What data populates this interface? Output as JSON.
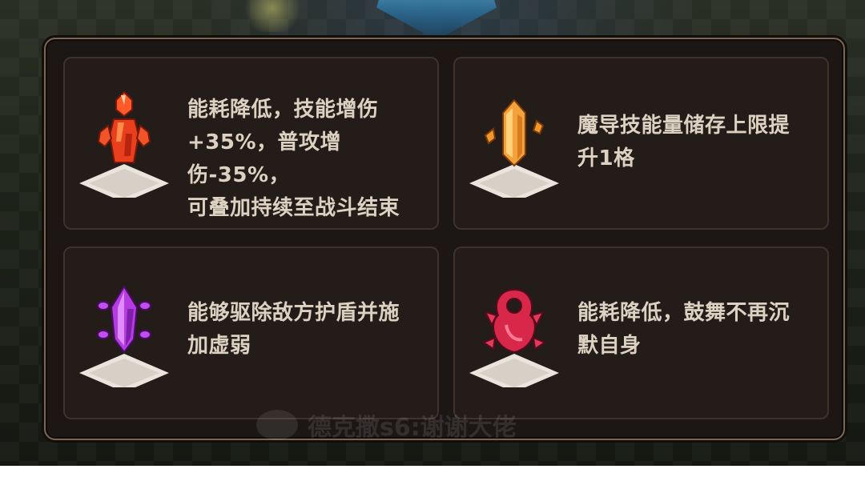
{
  "cards": [
    {
      "icon": "red-crystal-totem-icon",
      "description": "能耗降低，技能增伤\n+35%，普攻增伤-35%，\n可叠加持续至战斗结束",
      "accent": "#e8401f"
    },
    {
      "icon": "orange-crystal-icon",
      "description": "魔导技能量储存上限提\n升1格",
      "accent": "#f3a23b"
    },
    {
      "icon": "purple-crystal-icon",
      "description": "能够驱除敌方护盾并施\n加虚弱",
      "accent": "#b43ce0"
    },
    {
      "icon": "crimson-orb-icon",
      "description": "能耗降低，鼓舞不再沉\n默自身",
      "accent": "#d8284a"
    }
  ],
  "watermark": {
    "text": "德克撒s6:谢谢大佬"
  },
  "colors": {
    "panel_border": "#7b6651",
    "card_bg": "#231c19",
    "text": "#ddd2c2"
  }
}
